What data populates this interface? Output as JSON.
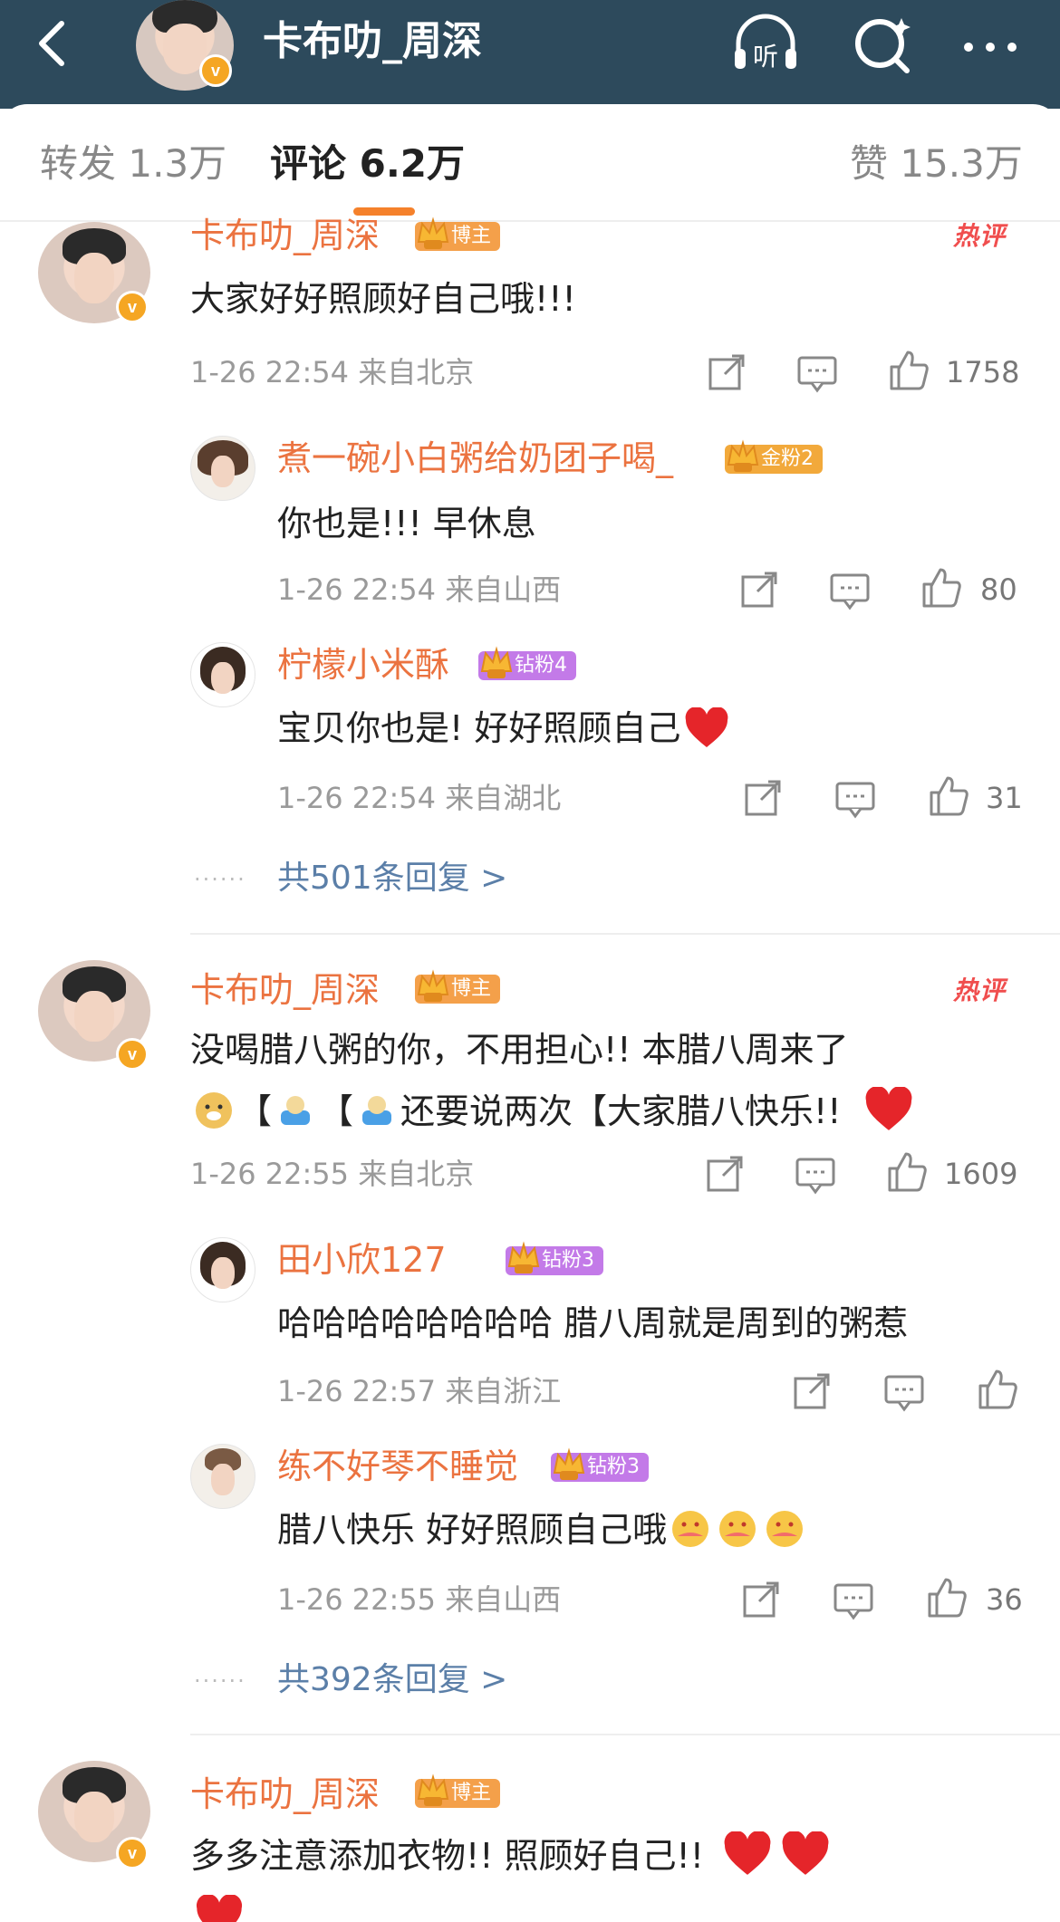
{
  "header": {
    "title": "卡布叻_周深",
    "listen_label": "听"
  },
  "tabs": [
    {
      "label": "转发 1.3万"
    },
    {
      "label": "评论 6.2万"
    },
    {
      "label": "赞 15.3万"
    }
  ],
  "badges": {
    "blogger": "博主",
    "gold2": "金粉2",
    "diamond4": "钻粉4",
    "diamond3": "钻粉3",
    "hot": "热评"
  },
  "comments": [
    {
      "author": "卡布叻_周深",
      "text": "大家好好照顾好自己哦!!!",
      "meta": "1-26 22:54 来自北京",
      "likes": "1758",
      "replies": [
        {
          "author": "煮一碗小白粥给奶团子喝_",
          "text": "你也是!!! 早休息",
          "meta": "1-26 22:54 来自山西",
          "likes": "80"
        },
        {
          "author": "柠檬小米酥",
          "text": "宝贝你也是! 好好照顾自己",
          "meta": "1-26 22:54 来自湖北",
          "likes": "31"
        }
      ],
      "more": "共501条回复 >"
    },
    {
      "author": "卡布叻_周深",
      "text_line1": "没喝腊八粥的你，不用担心!! 本腊八周来了",
      "text_line2_a": "【",
      "text_line2_b": "【",
      "text_line2_c": "还要说两次【大家腊八快乐!!",
      "meta": "1-26 22:55 来自北京",
      "likes": "1609",
      "replies": [
        {
          "author": "田小欣127",
          "text": "哈哈哈哈哈哈哈哈 腊八周就是周到的粥惹",
          "meta": "1-26 22:57 来自浙江",
          "likes": ""
        },
        {
          "author": "练不好琴不睡觉",
          "text": "腊八快乐 好好照顾自己哦",
          "meta": "1-26 22:55 来自山西",
          "likes": "36"
        }
      ],
      "more": "共392条回复 >"
    },
    {
      "author": "卡布叻_周深",
      "text": "多多注意添加衣物!! 照顾好自己!!"
    }
  ],
  "dots_label": "······",
  "colors": {
    "header_bg": "#2d4a5c",
    "name": "#eb7340",
    "link": "#5b7fa8",
    "accent": "#f5812b",
    "hot": "#f04e4e"
  }
}
